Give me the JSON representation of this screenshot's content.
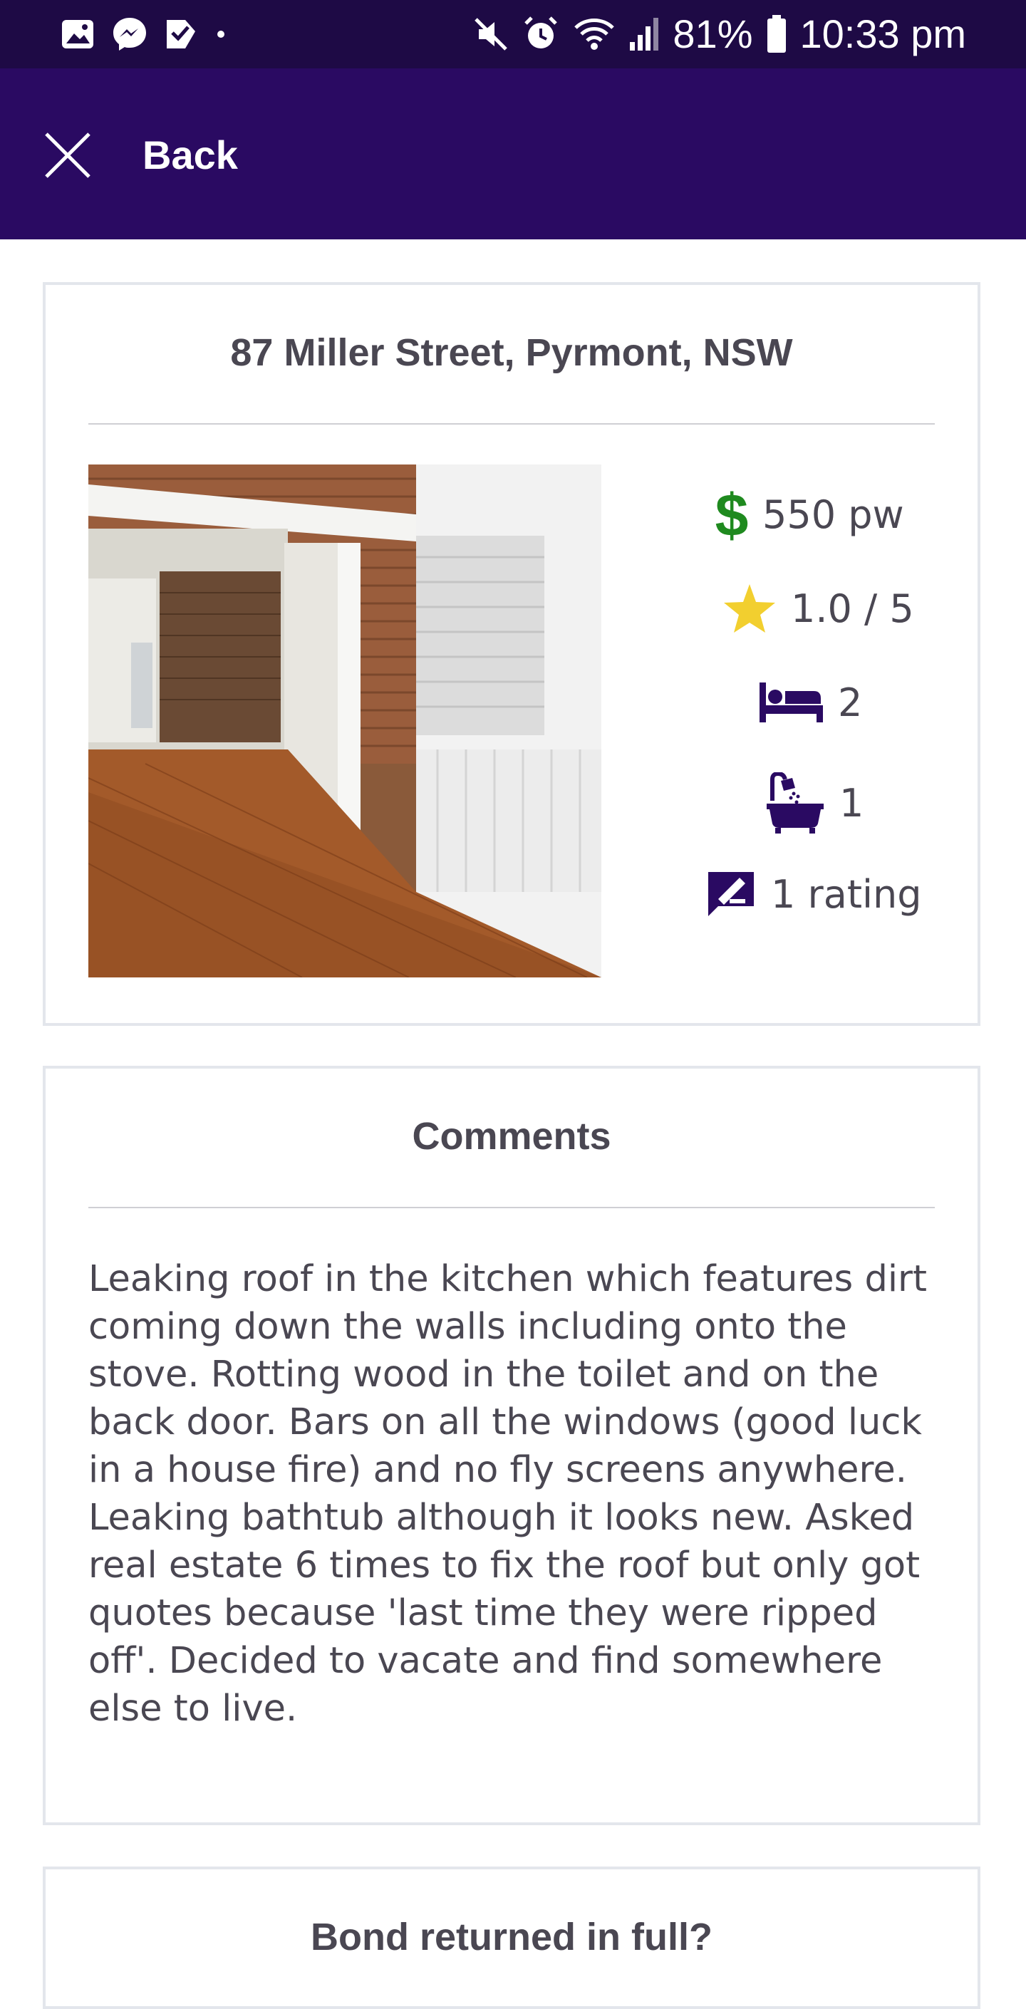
{
  "status_bar": {
    "battery": "81%",
    "time": "10:33 pm",
    "left_icons": [
      "gallery-icon",
      "messenger-icon",
      "check-app-icon",
      "dot-icon"
    ],
    "right_icons": [
      "mute-icon",
      "alarm-icon",
      "wifi-icon",
      "signal-icon",
      "battery-icon"
    ]
  },
  "app_bar": {
    "back_label": "Back",
    "background": "#2a0a62"
  },
  "property": {
    "address": "87 Miller Street, Pyrmont, NSW",
    "price": "550 pw",
    "rating": "1.0 / 5",
    "bedrooms": "2",
    "bathrooms": "1",
    "rating_count": "1 rating"
  },
  "comments": {
    "title": "Comments",
    "text": "Leaking roof in the kitchen which features dirt coming down the walls including onto the stove. Rotting wood in the toilet and on the back door. Bars on all the windows (good luck in a house fire) and no fly screens anywhere. Leaking bathtub although it looks new. Asked real estate 6 times to fix the roof but only got quotes because 'last time they were ripped off'. Decided to vacate and find somewhere else to live."
  },
  "bond": {
    "title": "Bond returned in full?"
  },
  "colors": {
    "dollar": "#1f8a1f",
    "star": "#f2cf2f",
    "icon_purple": "#2a0a62"
  }
}
